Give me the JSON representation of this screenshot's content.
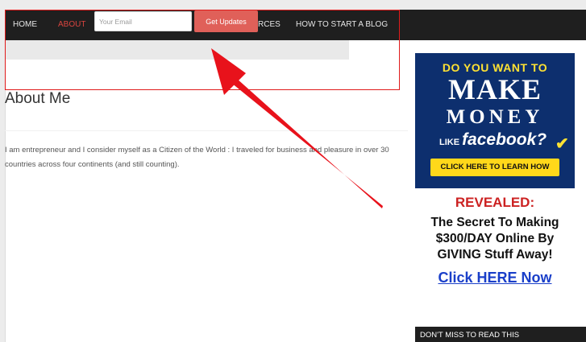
{
  "nav": {
    "items": [
      {
        "label": "HOME",
        "active": false
      },
      {
        "label": "ABOUT",
        "active": true
      },
      {
        "label": "RCES",
        "active": false
      },
      {
        "label": "HOW TO START A BLOG",
        "active": false
      }
    ]
  },
  "subscribe": {
    "email_placeholder": "Your Email",
    "button_label": "Get Updates"
  },
  "page": {
    "title": "About Me",
    "paragraph": "I am entrepreneur and I consider myself as a Citizen of the World : I traveled for business and pleasure in over 30 countries across four continents (and still counting)."
  },
  "sidebar": {
    "banner": {
      "line1": "DO YOU WANT TO",
      "line2": "MAKE",
      "line3": "MONEY",
      "like_prefix": "LIKE",
      "brand": "facebook?",
      "cta": "CLICK HERE TO LEARN HOW"
    },
    "ad": {
      "revealed": "REVEALED:",
      "body": "The Secret To Making $300/DAY Online By GIVING Stuff Away!",
      "link": "Click HERE Now"
    },
    "dont_miss": "DON'T MISS TO READ THIS"
  },
  "colors": {
    "nav_background": "#1f1f1f",
    "accent_red": "#d9443f",
    "button_background": "#e06059",
    "annotation_red": "#e01b1b",
    "banner_blue": "#0d2f6e",
    "link_blue": "#1a3fc9"
  },
  "icons": {
    "arrow": "annotation-arrow-icon",
    "check": "checkmark-icon"
  }
}
